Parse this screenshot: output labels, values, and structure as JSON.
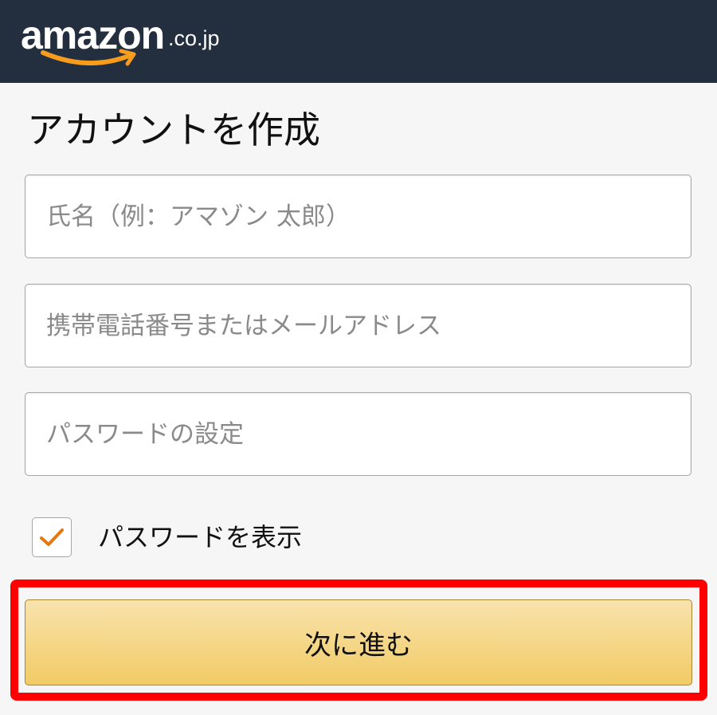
{
  "header": {
    "logo_word": "amazon",
    "logo_tld": ".co.jp",
    "background_color": "#232f3e",
    "smile_color": "#f89c1c"
  },
  "page_title": "アカウントを作成",
  "form": {
    "name_field": {
      "placeholder": "氏名（例：アマゾン 太郎）",
      "value": ""
    },
    "contact_field": {
      "placeholder": "携帯電話番号またはメールアドレス",
      "value": ""
    },
    "password_field": {
      "placeholder": "パスワードの設定",
      "value": ""
    },
    "show_password": {
      "label": "パスワードを表示",
      "checked": true,
      "check_color": "#e47911"
    },
    "next_button": {
      "label": "次に進む"
    }
  },
  "annotation": {
    "highlight_color": "#ff0000"
  }
}
